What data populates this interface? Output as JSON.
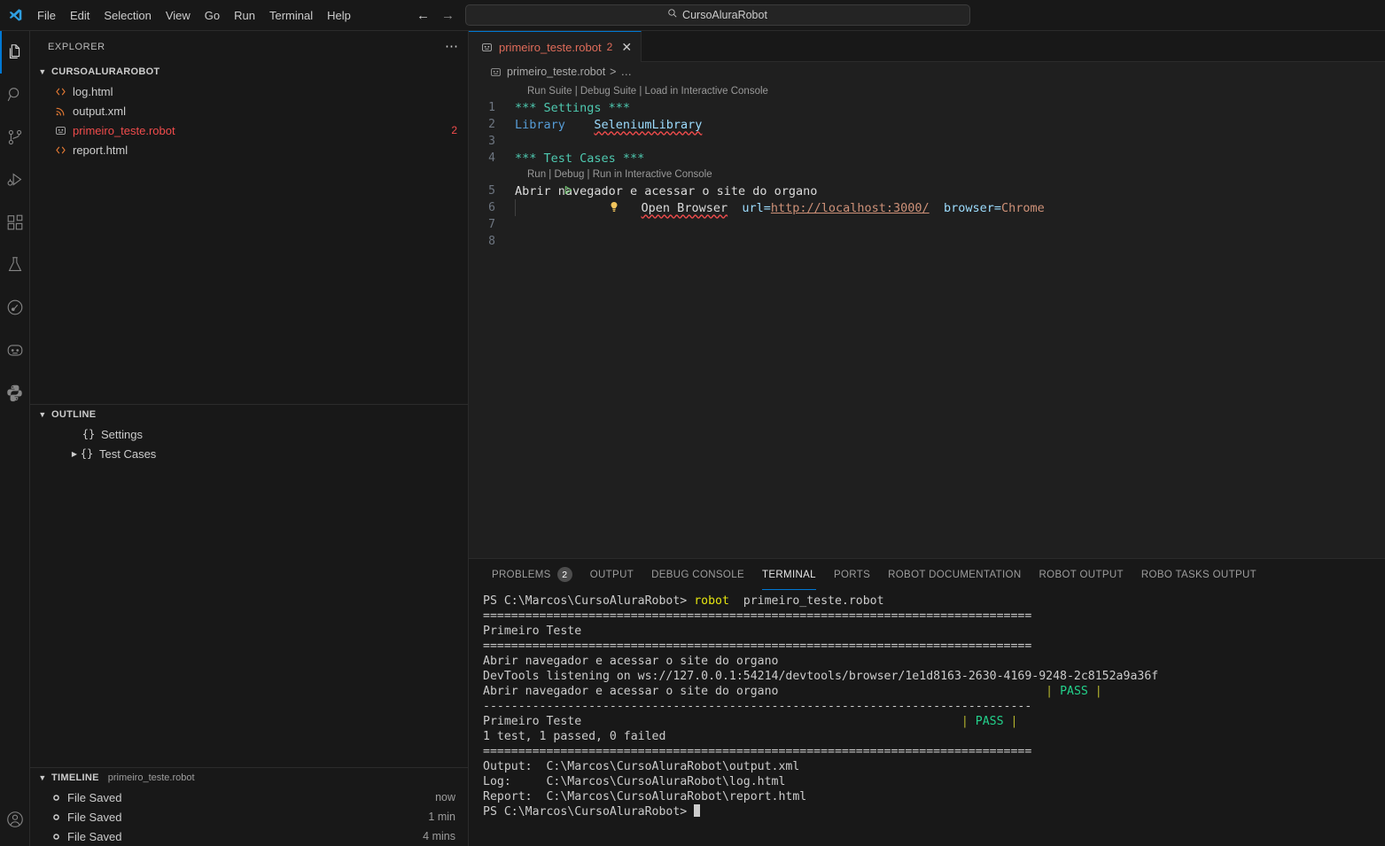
{
  "titlebar": {
    "logo_icon": "vscode-logo-icon",
    "menu": [
      "File",
      "Edit",
      "Selection",
      "View",
      "Go",
      "Run",
      "Terminal",
      "Help"
    ],
    "nav_back_icon": "arrow-left-icon",
    "nav_forward_icon": "arrow-right-icon",
    "quick_input": {
      "search_icon": "search-icon",
      "value": "CursoAluraRobot"
    }
  },
  "activitybar": {
    "items": [
      {
        "name": "explorer",
        "icon": "files-icon",
        "selected": true
      },
      {
        "name": "search",
        "icon": "search-icon",
        "selected": false
      },
      {
        "name": "source-control",
        "icon": "source-control-icon",
        "selected": false
      },
      {
        "name": "run-and-debug",
        "icon": "run-debug-icon",
        "selected": false
      },
      {
        "name": "extensions",
        "icon": "extensions-icon",
        "selected": false
      },
      {
        "name": "testing",
        "icon": "beaker-icon",
        "selected": false
      },
      {
        "name": "robot-framework-interactive",
        "icon": "circle-play-icon",
        "selected": false
      },
      {
        "name": "robot-framework",
        "icon": "robot-icon",
        "selected": false
      },
      {
        "name": "python",
        "icon": "python-icon",
        "selected": false
      }
    ],
    "account_icon": "account-icon"
  },
  "sidebar": {
    "header": {
      "title": "EXPLORER",
      "more_icon": "ellipsis-icon"
    },
    "explorer": {
      "root": "CURSOALURAROBOT",
      "files": [
        {
          "name": "log.html",
          "icon": "html-file-icon",
          "color": "#cccccc",
          "badge": ""
        },
        {
          "name": "output.xml",
          "icon": "xml-file-icon",
          "color": "#cccccc",
          "badge": ""
        },
        {
          "name": "primeiro_teste.robot",
          "icon": "robot-file-icon",
          "color": "#f14c4c",
          "badge": "2"
        },
        {
          "name": "report.html",
          "icon": "html-file-icon",
          "color": "#cccccc",
          "badge": ""
        }
      ]
    },
    "outline": {
      "title": "OUTLINE",
      "items": [
        {
          "label": "Settings",
          "icon": "namespace-icon",
          "expandable": false
        },
        {
          "label": "Test Cases",
          "icon": "namespace-icon",
          "expandable": true
        }
      ]
    },
    "timeline": {
      "title": "TIMELINE",
      "subtitle": "primeiro_teste.robot",
      "items": [
        {
          "label": "File Saved",
          "when": "now",
          "icon": "circle-outline-icon"
        },
        {
          "label": "File Saved",
          "when": "1 min",
          "icon": "circle-outline-icon"
        },
        {
          "label": "File Saved",
          "when": "4 mins",
          "icon": "circle-outline-icon"
        }
      ]
    }
  },
  "editor": {
    "tab": {
      "icon": "robot-file-icon",
      "label": "primeiro_teste.robot",
      "count": "2",
      "close_icon": "close-icon"
    },
    "breadcrumb": {
      "icon": "robot-file-icon",
      "file": "primeiro_teste.robot",
      "separator": ">",
      "more": "…"
    },
    "codelens_suite": "Run Suite | Debug Suite | Load in Interactive Console",
    "codelens_test": "Run | Debug | Run in Interactive Console",
    "lines": [
      {
        "no": "1",
        "text": "*** Settings ***"
      },
      {
        "no": "2",
        "text": "Library    SeleniumLibrary"
      },
      {
        "no": "3",
        "text": ""
      },
      {
        "no": "4",
        "text": "*** Test Cases ***"
      },
      {
        "no": "5",
        "text": "Abrir navegador e acessar o site do organo"
      },
      {
        "no": "6",
        "text": "    Open Browser    url=http://localhost:3000/    browser=Chrome"
      },
      {
        "no": "7",
        "text": ""
      },
      {
        "no": "8",
        "text": ""
      }
    ],
    "tokens": {
      "settings_header": "*** Settings ***",
      "library_kw": "Library",
      "library_val": "SeleniumLibrary",
      "testcases_header": "*** Test Cases ***",
      "test_name": "Abrir navegador e acessar o site do organo",
      "keyword": "Open Browser",
      "arg_url_name": "url=",
      "arg_url_value": "http://localhost:3000/",
      "arg_browser_name": "browser=",
      "arg_browser_value": "Chrome"
    },
    "glyphs": {
      "run_test_icon": "run-test-arrow-icon",
      "lightbulb_icon": "lightbulb-icon"
    }
  },
  "panel": {
    "tabs": [
      {
        "label": "PROBLEMS",
        "badge": "2",
        "active": false
      },
      {
        "label": "OUTPUT",
        "badge": "",
        "active": false
      },
      {
        "label": "DEBUG CONSOLE",
        "badge": "",
        "active": false
      },
      {
        "label": "TERMINAL",
        "badge": "",
        "active": true
      },
      {
        "label": "PORTS",
        "badge": "",
        "active": false
      },
      {
        "label": "ROBOT DOCUMENTATION",
        "badge": "",
        "active": false
      },
      {
        "label": "ROBOT OUTPUT",
        "badge": "",
        "active": false
      },
      {
        "label": "ROBO TASKS OUTPUT",
        "badge": "",
        "active": false
      }
    ],
    "terminal": {
      "prompt": "PS C:\\Marcos\\CursoAluraRobot> ",
      "command": "robot",
      "command_arg": "  primeiro_teste.robot",
      "rule_equals": "==============================================================================",
      "rule_dashes": "------------------------------------------------------------------------------",
      "suite_name": "Primeiro Teste",
      "test_line": "Abrir navegador e acessar o site do organo",
      "devtools_line": "DevTools listening on ws://127.0.0.1:54214/devtools/browser/1e1d8163-2630-4169-9248-2c8152a9a36f",
      "test_result_pad": "                                      ",
      "suite_result_pad": "                                                      ",
      "pass_open": "| ",
      "pass_label": "PASS",
      "pass_close": " |",
      "summary": "1 test, 1 passed, 0 failed",
      "output_label": "Output:  ",
      "output_path": "C:\\Marcos\\CursoAluraRobot\\output.xml",
      "log_label": "Log:     ",
      "log_path": "C:\\Marcos\\CursoAluraRobot\\log.html",
      "report_label": "Report:  ",
      "report_path": "C:\\Marcos\\CursoAluraRobot\\report.html",
      "final_prompt": "PS C:\\Marcos\\CursoAluraRobot> "
    }
  },
  "colors": {
    "accent": "#0078d4",
    "pass_green": "#23d18b",
    "error_red": "#f14c4c",
    "terminal_yellow": "#e5e510",
    "file_icon_orange": "#e37933"
  }
}
